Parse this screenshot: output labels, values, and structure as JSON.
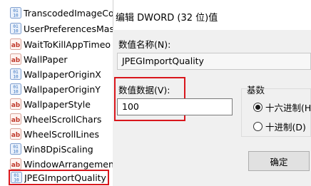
{
  "registry_values": [
    {
      "name": "TranscodedImageCo",
      "icon": "reg-dword-icon"
    },
    {
      "name": "UserPreferencesMas",
      "icon": "reg-dword-icon"
    },
    {
      "name": "WaitToKillAppTimeo",
      "icon": "reg-string-icon"
    },
    {
      "name": "WallPaper",
      "icon": "reg-string-icon"
    },
    {
      "name": "WallpaperOriginX",
      "icon": "reg-dword-icon"
    },
    {
      "name": "WallpaperOriginY",
      "icon": "reg-dword-icon"
    },
    {
      "name": "WallpaperStyle",
      "icon": "reg-string-icon"
    },
    {
      "name": "WheelScrollChars",
      "icon": "reg-string-icon"
    },
    {
      "name": "WheelScrollLines",
      "icon": "reg-string-icon"
    },
    {
      "name": "Win8DpiScaling",
      "icon": "reg-dword-icon"
    },
    {
      "name": "WindowArrangement",
      "icon": "reg-string-icon"
    },
    {
      "name": "JPEGImportQuality",
      "icon": "reg-dword-icon",
      "selected": true
    }
  ],
  "dialog": {
    "title": "编辑 DWORD (32 位)值",
    "value_name_label": "数值名称(N):",
    "value_name": "JPEGImportQuality",
    "value_data_label": "数值数据(V):",
    "value_data": "100",
    "base_label": "基数",
    "base_options": [
      {
        "label": "十六进制(H)",
        "checked": true
      },
      {
        "label": "十进制(D)",
        "checked": false
      }
    ],
    "ok_label": "确定"
  },
  "colors": {
    "highlight": "#d9161c",
    "dword_icon": "#2f6dbd",
    "string_icon": "#c0392b"
  }
}
